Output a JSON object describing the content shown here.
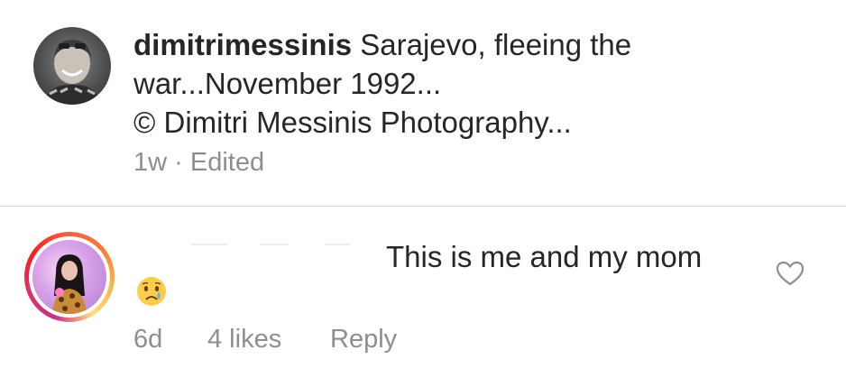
{
  "caption": {
    "username": "dimitrimessinis",
    "text": " Sarajevo, fleeing the war...November 1992...",
    "credit": "© Dimitri Messinis Photography...",
    "time": "1w",
    "separator": " · ",
    "edited_label": "Edited"
  },
  "comment": {
    "text": "This is me and my mom",
    "emoji": "😢",
    "time": "6d",
    "likes_label": "4 likes",
    "reply_label": "Reply"
  },
  "icons": {
    "like": "heart-outline-icon",
    "reaction": "crying-face-emoji"
  },
  "colors": {
    "text_primary": "#262626",
    "text_secondary": "#8e8e8e",
    "divider": "#dbdbdb",
    "story_ring_start": "#c13584",
    "story_ring_end": "#fcaf45"
  }
}
